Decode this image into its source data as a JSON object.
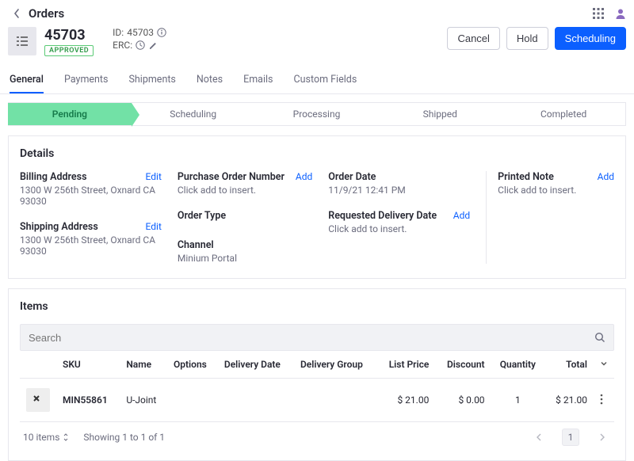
{
  "topbar": {
    "title": "Orders"
  },
  "order": {
    "number": "45703",
    "status_badge": "APPROVED",
    "id_label": "ID:",
    "id_value": "45703",
    "erc_label": "ERC:"
  },
  "actions": {
    "cancel": "Cancel",
    "hold": "Hold",
    "scheduling": "Scheduling"
  },
  "tabs": [
    "General",
    "Payments",
    "Shipments",
    "Notes",
    "Emails",
    "Custom Fields"
  ],
  "stages": [
    "Pending",
    "Scheduling",
    "Processing",
    "Shipped",
    "Completed"
  ],
  "details": {
    "title": "Details",
    "billing_label": "Billing Address",
    "billing_value": "1300 W 256th Street, Oxnard CA 93030",
    "shipping_label": "Shipping Address",
    "shipping_value": "1300 W 256th Street, Oxnard CA 93030",
    "po_label": "Purchase Order Number",
    "click_add": "Click add to insert.",
    "ordertype_label": "Order Type",
    "channel_label": "Channel",
    "channel_value": "Minium Portal",
    "orderdate_label": "Order Date",
    "orderdate_value": "11/9/21 12:41 PM",
    "requested_label": "Requested Delivery Date",
    "printed_label": "Printed Note",
    "edit": "Edit",
    "add": "Add"
  },
  "items": {
    "title": "Items",
    "search_placeholder": "Search",
    "columns": {
      "sku": "SKU",
      "name": "Name",
      "options": "Options",
      "delivery_date": "Delivery Date",
      "delivery_group": "Delivery Group",
      "list_price": "List Price",
      "discount": "Discount",
      "quantity": "Quantity",
      "total": "Total"
    },
    "rows": [
      {
        "sku": "MIN55861",
        "name": "U-Joint",
        "options": "",
        "delivery_date": "",
        "delivery_group": "",
        "list_price": "$ 21.00",
        "discount": "$ 0.00",
        "quantity": "1",
        "total": "$ 21.00"
      }
    ]
  },
  "pager": {
    "page_size": "10 items",
    "showing": "Showing 1 to 1 of 1",
    "current": "1"
  }
}
